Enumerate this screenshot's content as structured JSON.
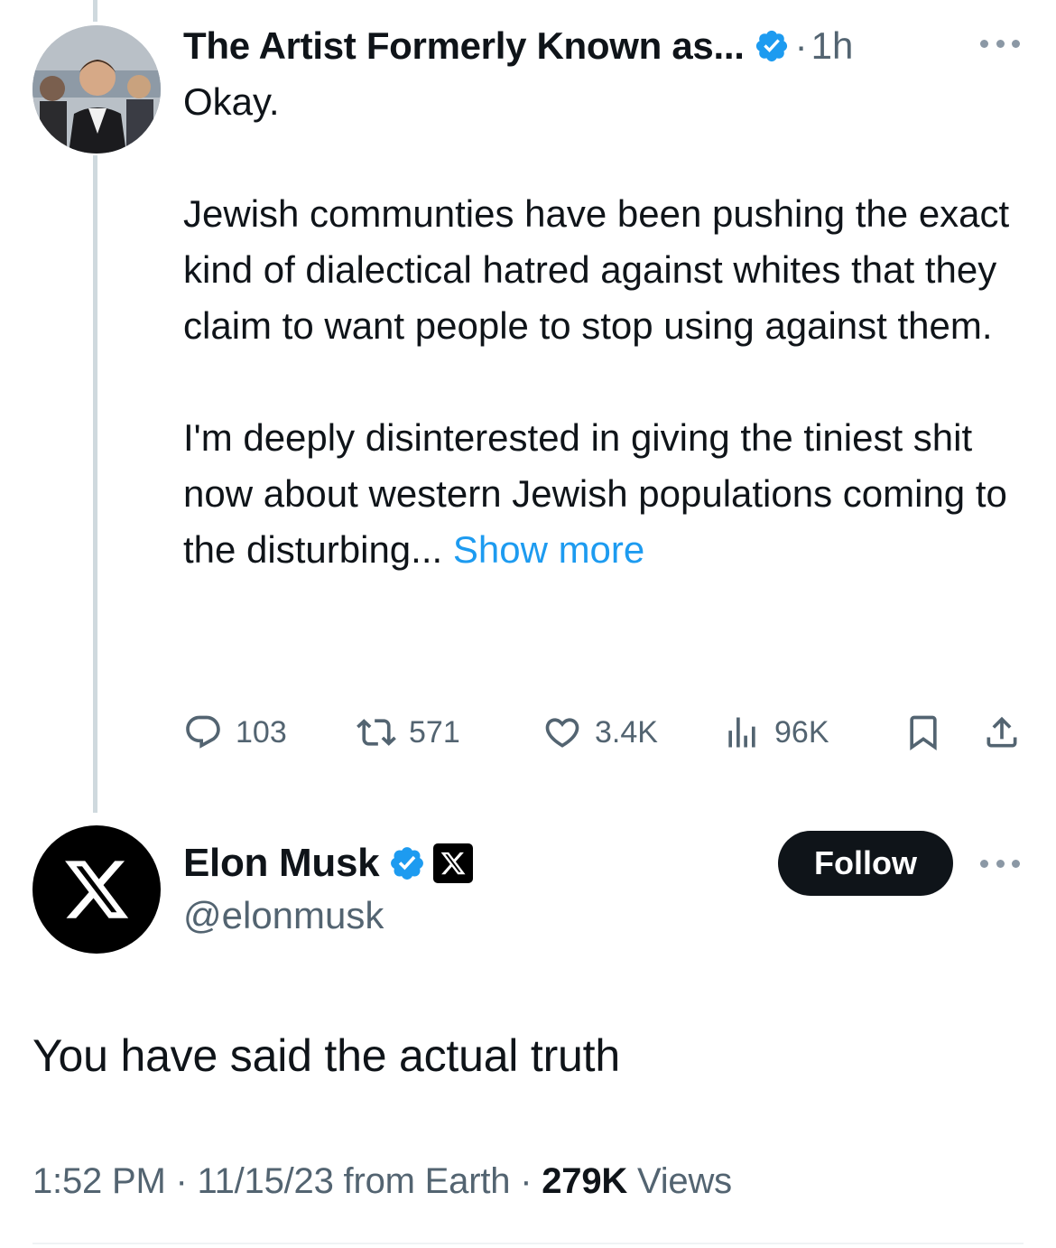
{
  "parent_tweet": {
    "author_name": "The Artist Formerly Known as...",
    "separator": "·",
    "time": "1h",
    "body_main": "Okay.\n\nJewish communties have been pushing the exact kind of dialectical hatred against whites that they claim to want people to stop using against them.\n\nI'm deeply disinterested in giving the tiniest shit now about western Jewish populations coming to the disturbing...",
    "show_more": " Show more",
    "actions": {
      "replies": "103",
      "reposts": "571",
      "likes": "3.4K",
      "views": "96K"
    }
  },
  "main_tweet": {
    "author_name": "Elon Musk",
    "handle": "@elonmusk",
    "follow_label": "Follow",
    "text": "You have said the actual truth",
    "meta_time": "1:52 PM · 11/15/23 from Earth · ",
    "views_count": "279K",
    "views_label": " Views"
  },
  "colors": {
    "accent": "#1d9bf0",
    "text_primary": "#0f1419",
    "text_secondary": "#536471",
    "thread_line": "#cfd9de"
  },
  "icons": {
    "verified": "verified-badge-icon",
    "affiliate": "x-logo-icon",
    "reply": "reply-icon",
    "repost": "repost-icon",
    "like": "heart-icon",
    "views": "views-bar-icon",
    "bookmark": "bookmark-icon",
    "share": "share-icon",
    "more": "more-dots-icon"
  }
}
